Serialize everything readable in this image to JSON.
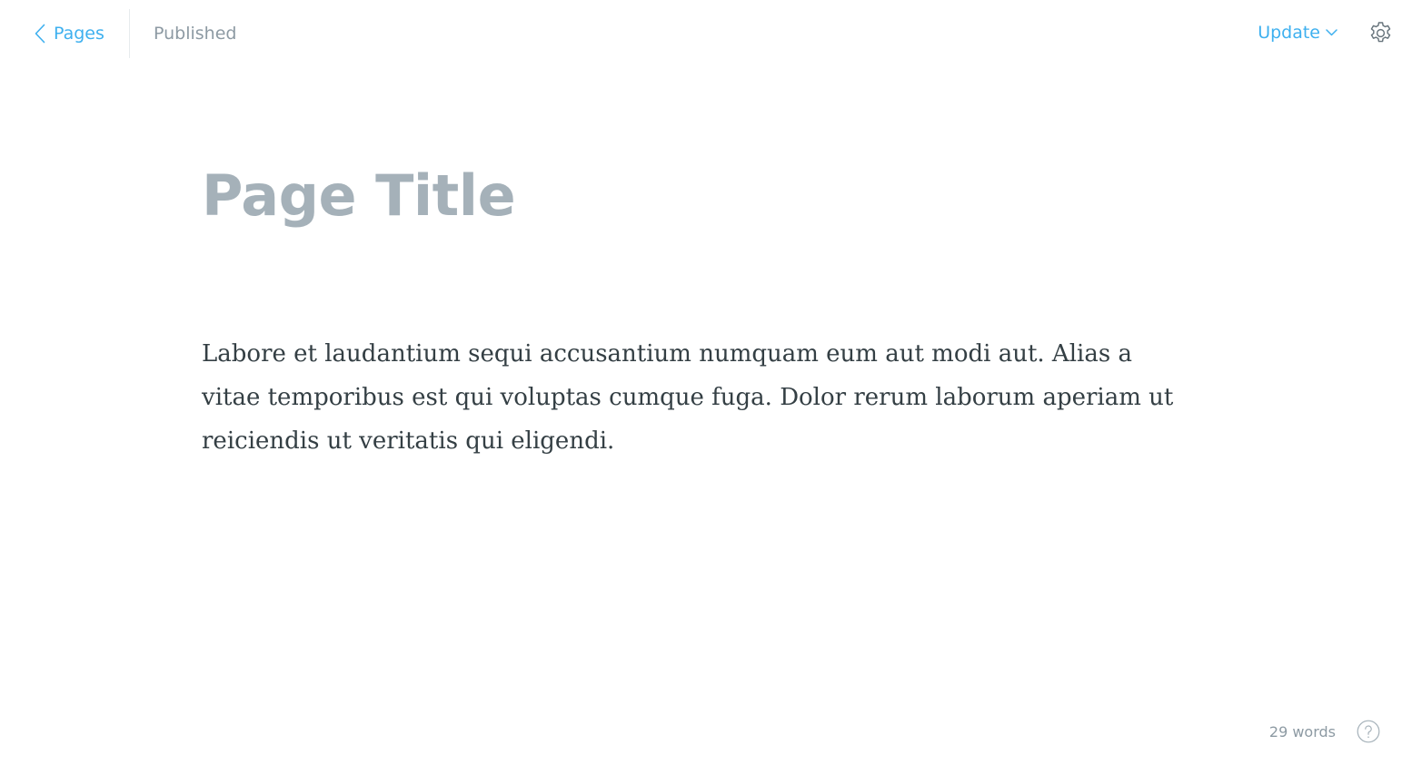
{
  "header": {
    "back_label": "Pages",
    "status": "Published",
    "update_label": "Update"
  },
  "editor": {
    "title": "Page Title",
    "body": "Labore et laudantium sequi accusantium numquam eum aut modi aut. Alias a vitae temporibus est qui voluptas cumque fuga. Dolor rerum laborum aperiam ut reiciendis ut veritatis qui eligendi."
  },
  "footer": {
    "word_count": "29 words"
  },
  "icons": {
    "back": "chevron-left-icon",
    "update_menu": "chevron-down-icon",
    "settings": "gear-icon",
    "help": "question-circle-icon"
  },
  "colors": {
    "accent": "#3eb0ef",
    "muted_text": "#8d9aa3",
    "title_text": "#a5b1b9",
    "body_text": "#343f44",
    "divider": "#e7ebee"
  }
}
